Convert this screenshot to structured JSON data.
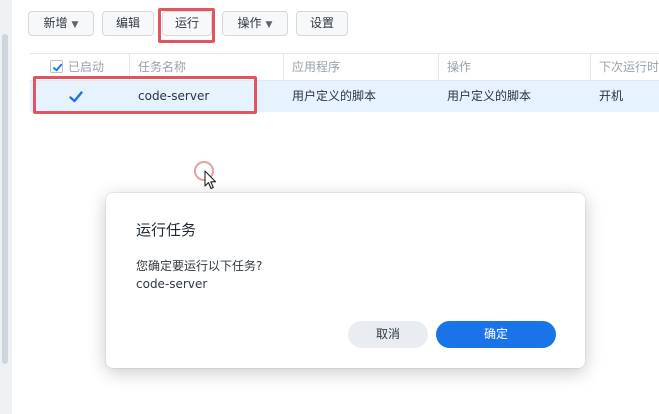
{
  "toolbar": {
    "create_label": "新增",
    "edit_label": "编辑",
    "run_label": "运行",
    "action_label": "操作",
    "settings_label": "设置"
  },
  "table": {
    "columns": [
      "已启动",
      "任务名称",
      "应用程序",
      "操作",
      "下次运行时"
    ],
    "rows": [
      {
        "enabled": true,
        "name": "code-server",
        "application": "用户定义的脚本",
        "action": "用户定义的脚本",
        "next_run": "开机"
      }
    ]
  },
  "dialog": {
    "title": "运行任务",
    "message": "您确定要运行以下任务?",
    "task_name": "code-server",
    "cancel_label": "取消",
    "confirm_label": "确定"
  },
  "colors": {
    "accent": "#1a73e8",
    "highlight": "#e05560",
    "selected_row": "#e6f2fd"
  }
}
